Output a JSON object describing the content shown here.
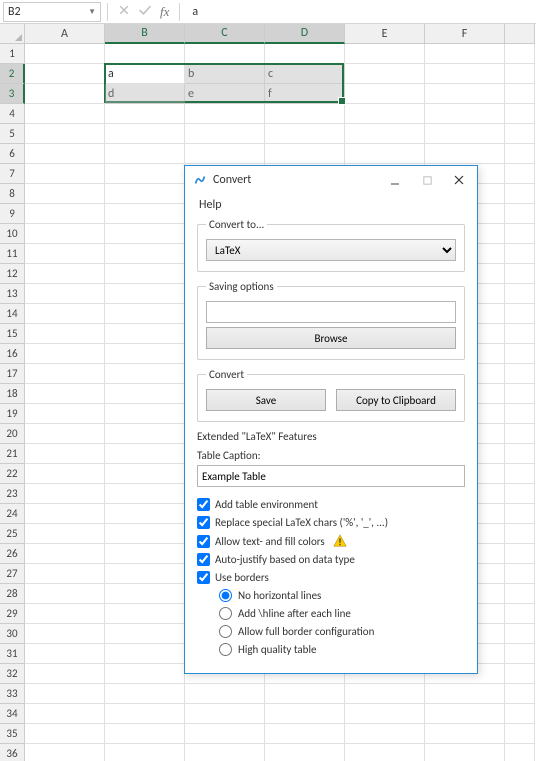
{
  "namebox": {
    "value": "B2"
  },
  "formula": {
    "value": "a"
  },
  "columns": [
    "A",
    "B",
    "C",
    "D",
    "E",
    "F"
  ],
  "sel_cols": [
    "B",
    "C",
    "D"
  ],
  "sel_rows": [
    2,
    3
  ],
  "row_count": 36,
  "cells": {
    "B2": "a",
    "C2": "b",
    "D2": "c",
    "B3": "d",
    "C3": "e",
    "D3": "f"
  },
  "dialog": {
    "title": "Convert",
    "help": "Help",
    "convert_to": {
      "legend": "Convert to...",
      "value": "LaTeX"
    },
    "saving": {
      "legend": "Saving options",
      "path": "",
      "browse": "Browse"
    },
    "convert": {
      "legend": "Convert",
      "save": "Save",
      "copy": "Copy to Clipboard"
    },
    "ext": {
      "title": "Extended \"LaTeX\" Features",
      "caption_label": "Table Caption:",
      "caption": "Example Table",
      "cb_env": "Add table environment",
      "cb_specials": "Replace special LaTeX chars ('%', '_', ...)",
      "cb_colors": "Allow text- and fill colors",
      "cb_justify": "Auto-justify based on data type",
      "cb_borders": "Use borders",
      "rb_nohline": "No horizontal lines",
      "rb_hline": "Add \\hline after each line",
      "rb_fullborder": "Allow full border configuration",
      "rb_hq": "High quality table"
    }
  }
}
